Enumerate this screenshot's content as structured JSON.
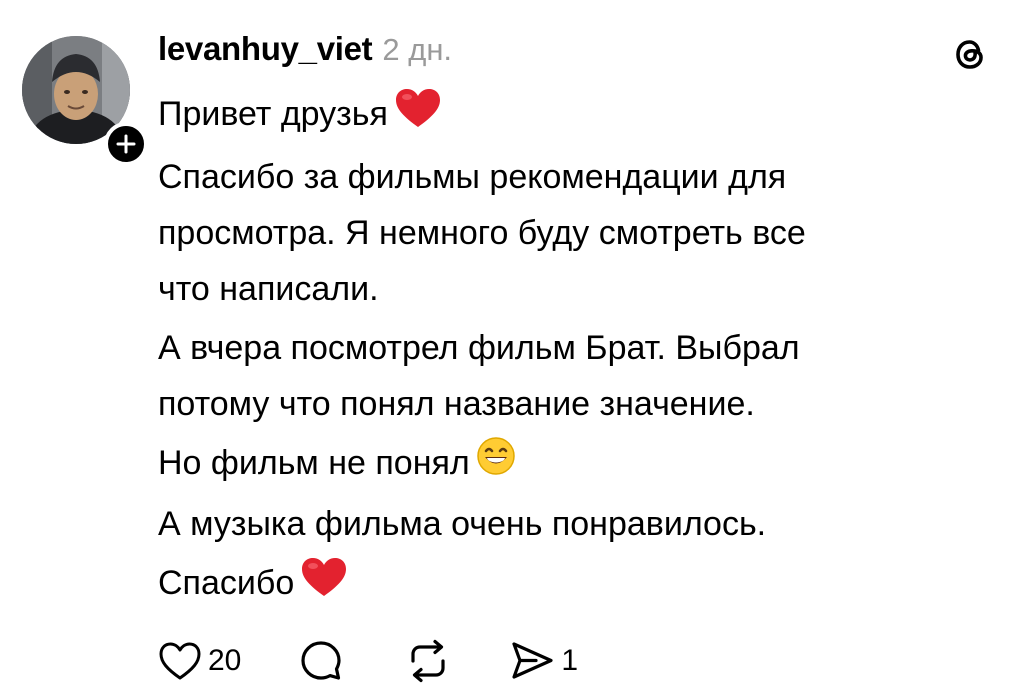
{
  "post": {
    "username": "levanhuy_viet",
    "timestamp": "2 дн.",
    "paragraphs": {
      "p1": {
        "text": "Привет друзья",
        "emoji": "red-heart"
      },
      "p2": {
        "line1": "Спасибо за фильмы рекомендации для",
        "line2": "просмотра. Я немного буду смотреть все",
        "line3": "что написали."
      },
      "p3": {
        "line1": "А вчера посмотрел фильм Брат. Выбрал",
        "line2": "потому что понял название значение."
      },
      "p4": {
        "text": "Но фильм не понял",
        "emoji": "grinning-face"
      },
      "p5": {
        "text": "А музыка фильма очень понравилось."
      },
      "p6": {
        "text": "Спасибо",
        "emoji": "red-heart"
      }
    },
    "actions": {
      "like_count": "20",
      "share_count": "1"
    }
  },
  "icons": {
    "follow": "plus-icon",
    "app": "threads-logo",
    "like": "heart-icon",
    "reply": "comment-icon",
    "repost": "repost-icon",
    "share": "send-icon"
  },
  "colors": {
    "text": "#000000",
    "muted": "#9a9a9a",
    "heart": "#e3222f",
    "background": "#ffffff"
  }
}
